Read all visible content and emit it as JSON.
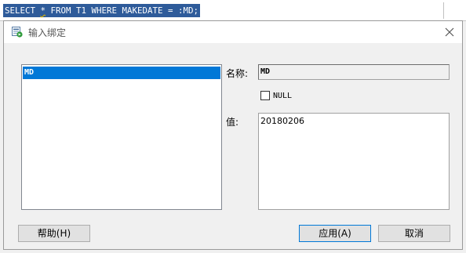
{
  "editor": {
    "sql_prefix": "SELECT ",
    "sql_star": "*",
    "sql_suffix": " FROM T1 WHERE MAKEDATE = :MD;"
  },
  "dialog": {
    "title": "输入绑定",
    "close_symbol": "×",
    "bind_list": [
      {
        "label": "MD"
      }
    ],
    "name_label": "名称:",
    "name_value": "MD",
    "null_label": "NULL",
    "null_checked": false,
    "value_label": "值:",
    "value": "20180206",
    "buttons": {
      "help": "帮助(H)",
      "apply": "应用(A)",
      "cancel": "取消"
    }
  },
  "icons": {
    "title": "bind-variable-icon",
    "close": "close-icon"
  },
  "colors": {
    "selection": "#0078d7",
    "sql_highlight": "#2e5b9a"
  }
}
